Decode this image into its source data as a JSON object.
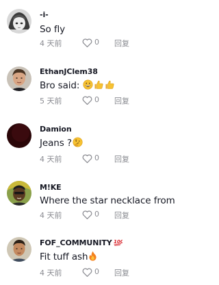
{
  "comments": [
    {
      "username": "-i-",
      "text": "So fly",
      "time": "4 天前",
      "likes": "0",
      "reply_label": "回复",
      "avatar": "anime-character-avatar",
      "emojis": []
    },
    {
      "username": "EthanJClem38",
      "text": "Bro said: ",
      "time": "5 天前",
      "likes": "0",
      "reply_label": "回复",
      "avatar": "person-photo-avatar",
      "emojis": [
        "grinning-face-emoji",
        "thumbs-up-emoji",
        "thumbs-up-emoji"
      ]
    },
    {
      "username": "Damion",
      "text": "Jeans ?",
      "time": "4 天前",
      "likes": "0",
      "reply_label": "回复",
      "avatar": "dark-red-avatar",
      "emojis": [
        "thinking-face-emoji"
      ]
    },
    {
      "username": "M!KE",
      "text": "Where the star necklace from",
      "time": "4 天前",
      "likes": "0",
      "reply_label": "回复",
      "avatar": "person-photo-avatar",
      "emojis": []
    },
    {
      "username": "FOF_COMMUNITY",
      "text": "Fit tuff ash",
      "time": "4 天前",
      "likes": "0",
      "reply_label": "回复",
      "avatar": "person-photo-avatar",
      "emojis": [
        "fire-emoji"
      ],
      "badge": "100-emoji"
    }
  ],
  "colors": {
    "text": "#161823",
    "muted": "#8a8b91",
    "background": "#ffffff"
  }
}
